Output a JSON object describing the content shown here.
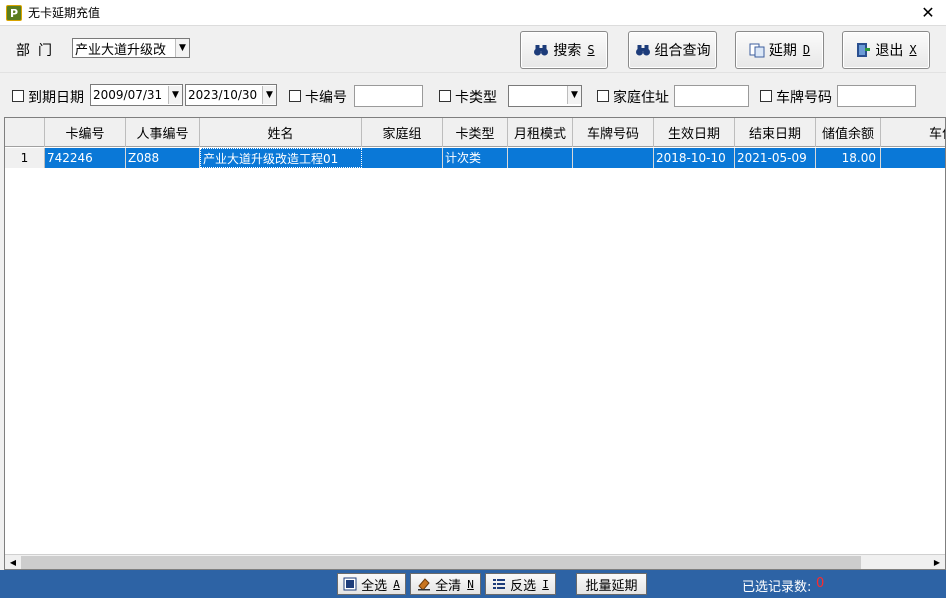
{
  "window": {
    "title": "无卡延期充值",
    "app_icon_letter": "P"
  },
  "toolbar": {
    "dept_label": "部门",
    "dept_value": "产业大道升级改",
    "buttons": {
      "search": {
        "label": "搜索",
        "hotkey": "S",
        "icon": "binoculars-icon"
      },
      "combo_query": {
        "label": "组合查询",
        "icon": "binoculars-icon"
      },
      "extend": {
        "label": "延期",
        "hotkey": "D",
        "icon": "copy-icon"
      },
      "exit": {
        "label": "退出",
        "hotkey": "X",
        "icon": "exit-door-icon"
      }
    }
  },
  "filters": {
    "expiry_label": "到期日期",
    "date_from": "2009/07/31",
    "date_to": "2023/10/30",
    "card_no_label": "卡编号",
    "card_type_label": "卡类型",
    "address_label": "家庭住址",
    "plate_label": "车牌号码"
  },
  "grid": {
    "columns": [
      "卡编号",
      "人事编号",
      "姓名",
      "家庭组",
      "卡类型",
      "月租模式",
      "车牌号码",
      "生效日期",
      "结束日期",
      "储值余额",
      "车位"
    ],
    "rows": [
      {
        "num": "1",
        "card_no": "742246",
        "staff_no": "Z088",
        "name": "产业大道升级改造工程01",
        "family_group": "",
        "card_type": "计次类",
        "rent_mode": "",
        "plate": "",
        "start_date": "2018-10-10",
        "end_date": "2021-05-09",
        "balance": "18.00",
        "space": ""
      }
    ]
  },
  "statusbar": {
    "select_all": {
      "label": "全选",
      "hotkey": "A"
    },
    "clear_all": {
      "label": "全清",
      "hotkey": "N"
    },
    "invert": {
      "label": "反选",
      "hotkey": "I"
    },
    "batch_extend": "批量延期",
    "count_label": "已选记录数:",
    "count_value": "0"
  },
  "colors": {
    "accent": "#0a78d7",
    "statusbar": "#2d63a5",
    "count": "#ff2a2a"
  }
}
